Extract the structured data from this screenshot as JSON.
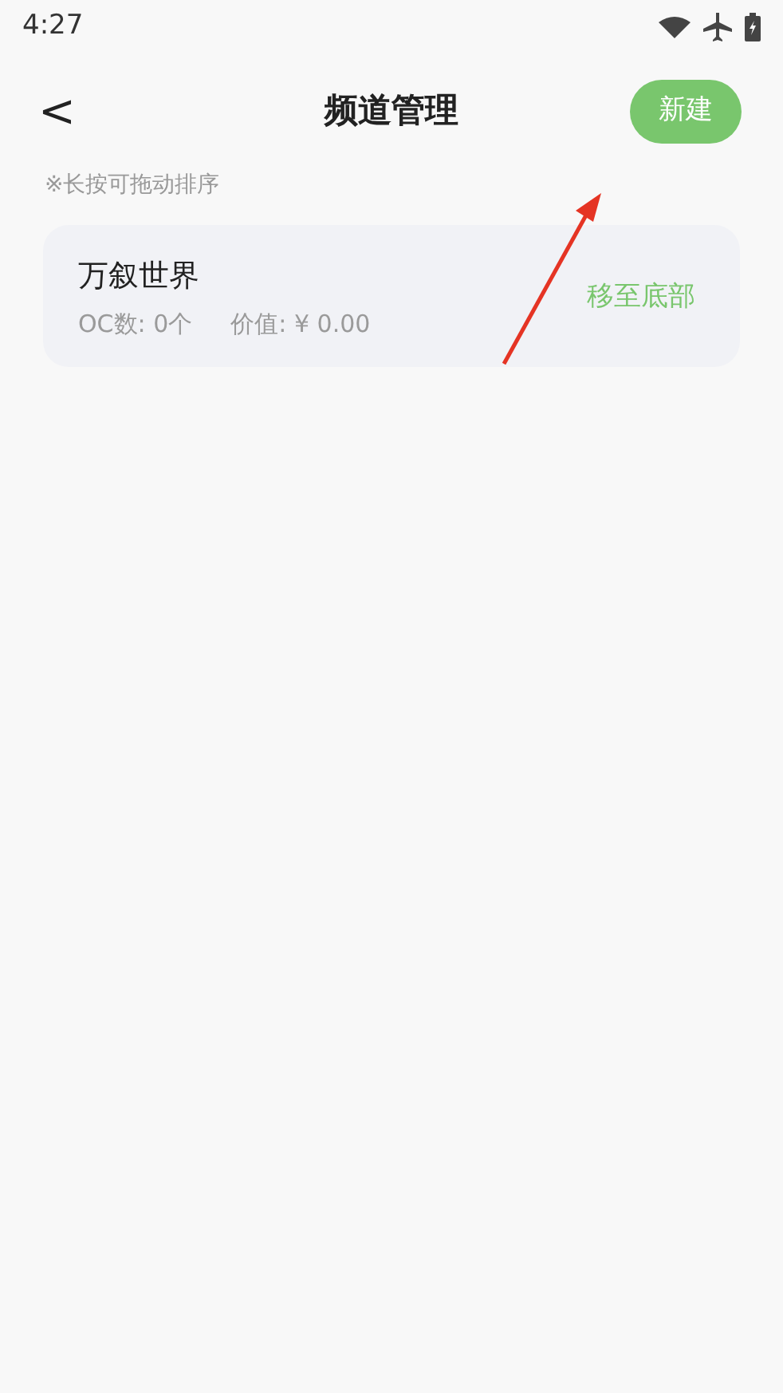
{
  "status_bar": {
    "time": "4:27"
  },
  "header": {
    "back": "<",
    "title": "频道管理",
    "new_button": "新建"
  },
  "hint": "※长按可拖动排序",
  "channels": [
    {
      "name": "万叙世界",
      "oc_count": "OC数: 0个",
      "value": "价值: ¥ 0.00",
      "action": "移至底部"
    }
  ]
}
